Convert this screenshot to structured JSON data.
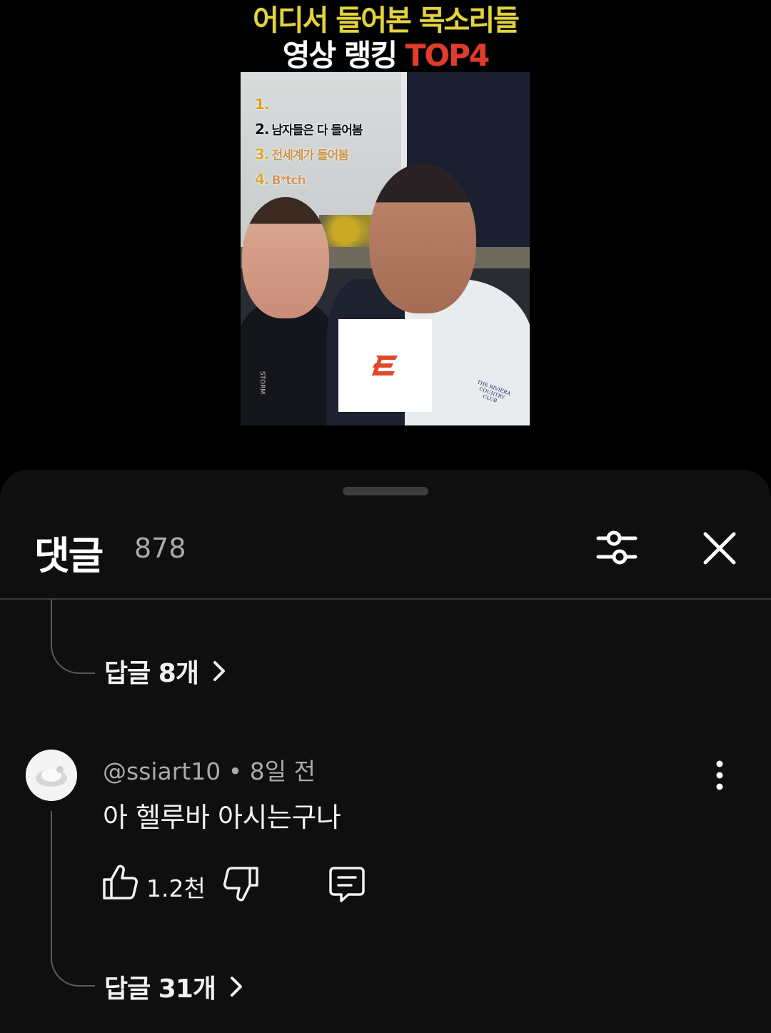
{
  "video": {
    "title_line1": "어디서 들어본 목소리들",
    "title_line2_prefix": "영상 랭킹 ",
    "title_line2_accent": "TOP4",
    "ranking": [
      {
        "num": "1.",
        "text": ""
      },
      {
        "num": "2.",
        "text": "남자들은 다 들어봄"
      },
      {
        "num": "3.",
        "text": "전세계가 들어봄"
      },
      {
        "num": "4.",
        "text": "B*tch"
      }
    ],
    "shirt_text": "THE RIVIERA COUNTRY CLUB",
    "jacket_text": "STORM"
  },
  "sheet": {
    "title": "댓글",
    "count": "878"
  },
  "replies_1": {
    "label": "답글 8개"
  },
  "comment": {
    "author": "@ssiart10",
    "separator": " • ",
    "time": "8일 전",
    "text": "아 헬루바 아시는구나",
    "likes": "1.2천"
  },
  "replies_2": {
    "label": "답글 31개"
  },
  "colors": {
    "title_yellow": "#e4d33a",
    "title_red": "#e23b2a",
    "sheet_bg": "#0f0f0f",
    "secondary_text": "#aaaaaa"
  },
  "icons": [
    "filter-icon",
    "close-icon",
    "chevron-right-icon",
    "more-vert-icon",
    "thumb-up-icon",
    "thumb-down-icon",
    "comment-icon"
  ]
}
